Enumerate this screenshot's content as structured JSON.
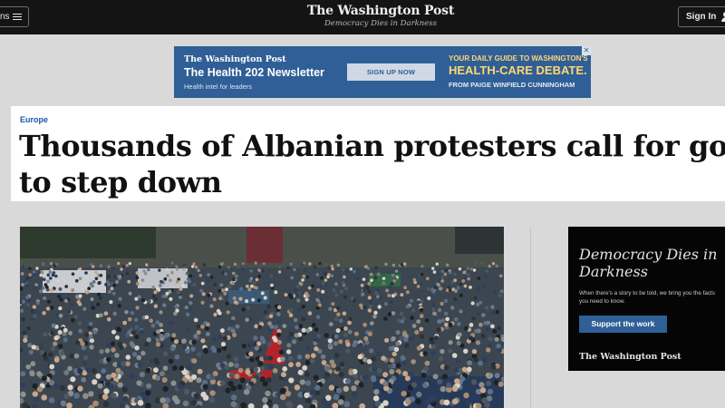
{
  "nav": {
    "sections_label": "ns",
    "logo": "The Washington Post",
    "tagline": "Democracy Dies in Darkness",
    "signin_label": "Sign In"
  },
  "ad": {
    "logo": "The Washington Post",
    "title": "The Health 202 Newsletter",
    "subtitle": "Health intel for leaders",
    "button": "SIGN UP NOW",
    "right_line1": "YOUR DAILY GUIDE TO WASHINGTON'S",
    "right_line2": "HEALTH-CARE DEBATE.",
    "right_line3": "FROM PAIGE WINFIELD CUNNINGHAM",
    "close": "✕"
  },
  "article": {
    "kicker": "Europe",
    "headline": "Thousands of Albanian protesters call for govt to step down"
  },
  "promo": {
    "title": "Democracy Dies in Darkness",
    "text": "When there's a story to be told, we bring you the facts you need to know.",
    "button": "Support the work",
    "logo": "The Washington Post"
  },
  "colors": {
    "nav_bg": "#141414",
    "ad_bg": "#2f5f96",
    "ad_accent": "#ffd773",
    "kicker": "#1955a5",
    "promo_bg": "#050505"
  }
}
